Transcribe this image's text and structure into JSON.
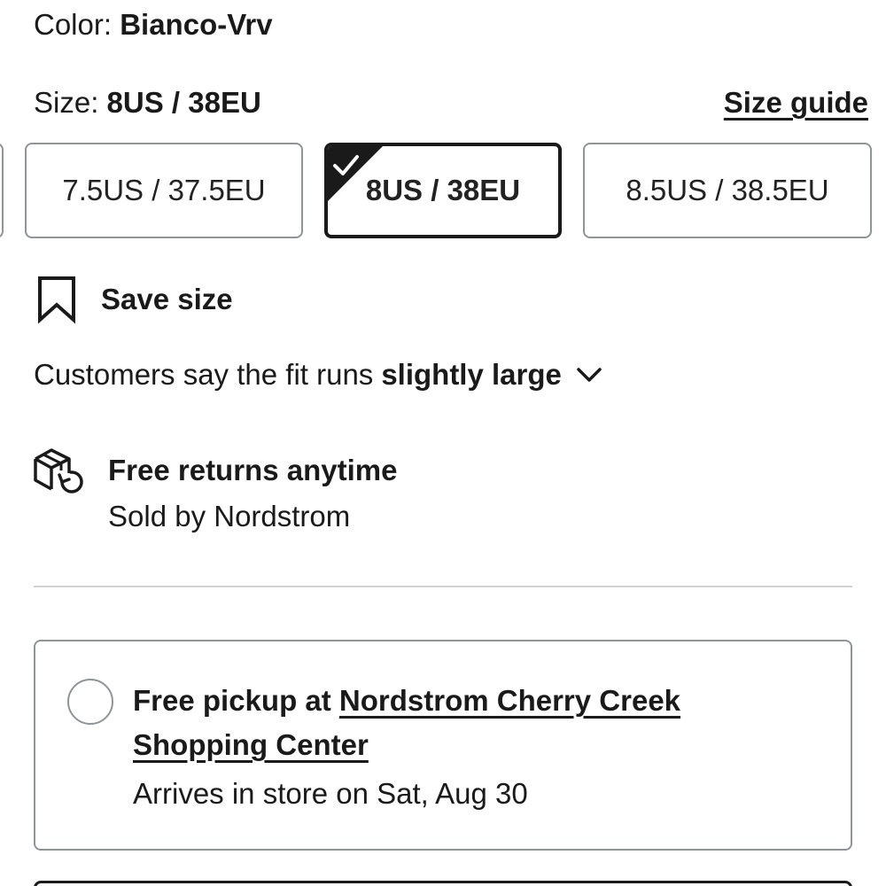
{
  "color": {
    "label": "Color:",
    "value": "Bianco-Vrv"
  },
  "size": {
    "label": "Size:",
    "value": "8US / 38EU",
    "guide_link": "Size guide",
    "options": [
      {
        "label": "7.5US / 37.5EU",
        "selected": false
      },
      {
        "label": "8US / 38EU",
        "selected": true
      },
      {
        "label": "8.5US / 38.5EU",
        "selected": false
      }
    ]
  },
  "save_size": {
    "label": "Save size",
    "icon": "bookmark-icon"
  },
  "fit": {
    "prefix": "Customers say the fit runs",
    "value": "slightly large",
    "icon": "chevron-down-icon"
  },
  "returns": {
    "title": "Free returns anytime",
    "subtitle": "Sold by Nordstrom",
    "icon": "return-box-icon"
  },
  "pickup": {
    "prefix": "Free pickup at",
    "store": "Nordstrom Cherry Creek Shopping Center",
    "arrival": "Arrives in store on Sat, Aug 30",
    "selected": false
  },
  "colors": {
    "text": "#1a1a1a",
    "border": "#8f9497",
    "divider": "#cfd3d5",
    "selected_border": "#1a1a1a"
  }
}
